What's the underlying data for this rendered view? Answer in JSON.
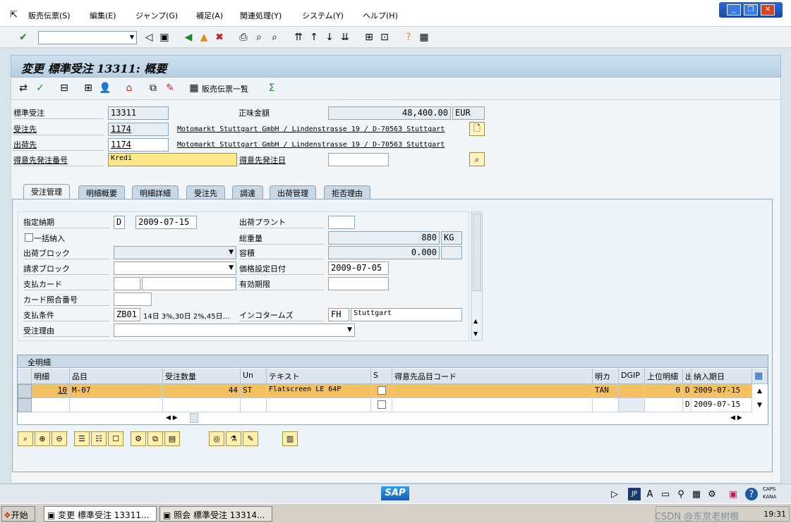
{
  "menu": [
    "販売伝票(S)",
    "編集(E)",
    "ジャンプ(G)",
    "補足(A)",
    "関連処理(Y)",
    "システム(Y)",
    "ヘルプ(H)"
  ],
  "page_title": "変更 標準受注 13311: 概要",
  "app_toolbar": {
    "list_label": "販売伝票一覧"
  },
  "header": {
    "order_type_label": "標準受注",
    "order_no": "13311",
    "net_label": "正味金額",
    "net_value": "48,400.00",
    "currency": "EUR",
    "soldto_label": "受注先",
    "soldto_no": "1174",
    "soldto_addr": "Motomarkt Stuttgart GmbH / Lindenstrasse 19 / D-70563 Stuttgart",
    "shipto_label": "出荷先",
    "shipto_no": "1174",
    "shipto_addr": "Motomarkt Stuttgart GmbH / Lindenstrasse 19 / D-70563 Stuttgart",
    "po_label": "得意先発注番号",
    "po_value": "Kredi",
    "po_date_label": "得意先発注日",
    "po_date_value": ""
  },
  "tabs": [
    "受注管理",
    "明細概要",
    "明細詳細",
    "受注先",
    "調達",
    "出荷管理",
    "拒否理由"
  ],
  "form": {
    "delivery_date_label": "指定納期",
    "delivery_date_type": "D",
    "delivery_date": "2009-07-15",
    "plant_label": "出荷プラント",
    "plant_value": "",
    "complete_label": "一括納入",
    "weight_label": "総重量",
    "weight_value": "880",
    "weight_unit": "KG",
    "ship_block_label": "出荷ブロック",
    "volume_label": "容積",
    "volume_value": "0.000",
    "bill_block_label": "請求ブロック",
    "pricing_date_label": "価格設定日付",
    "pricing_date": "2009-07-05",
    "card_label": "支払カード",
    "valid_label": "有効期限",
    "card_check_label": "カード照合番号",
    "terms_label": "支払条件",
    "terms_value": "ZB01",
    "terms_text": "14日 3%,30日 2%,45日…",
    "incoterms_label": "インコタームズ",
    "incoterms_value": "FH",
    "incoterms_place": "Stuttgart",
    "reason_label": "受注理由"
  },
  "grid": {
    "title": "全明細",
    "headers": [
      "明細",
      "品目",
      "受注数量",
      "Un",
      "テキスト",
      "S",
      "得意先品目コード",
      "明カ",
      "DGIP",
      "上位明細",
      "出",
      "納入期日"
    ],
    "row1": {
      "item": "10",
      "material": "M-07",
      "qty": "44",
      "unit": "ST",
      "text": "Flatscreen LE 64P",
      "cat": "TAN",
      "higher": "0",
      "type": "D",
      "date": "2009-07-15"
    },
    "row2": {
      "type": "D",
      "date": "2009-07-15"
    }
  },
  "statusbar": {
    "sap": "SAP",
    "jp": "JP",
    "caps": "CAPS",
    "kana": "KANA"
  },
  "taskbar": {
    "start": "开始",
    "task1": "変更 標準受注 13311...",
    "task2": "照会 標準受注 13314...",
    "watermark": "CSDN @东京老树根",
    "time": "19:31"
  }
}
